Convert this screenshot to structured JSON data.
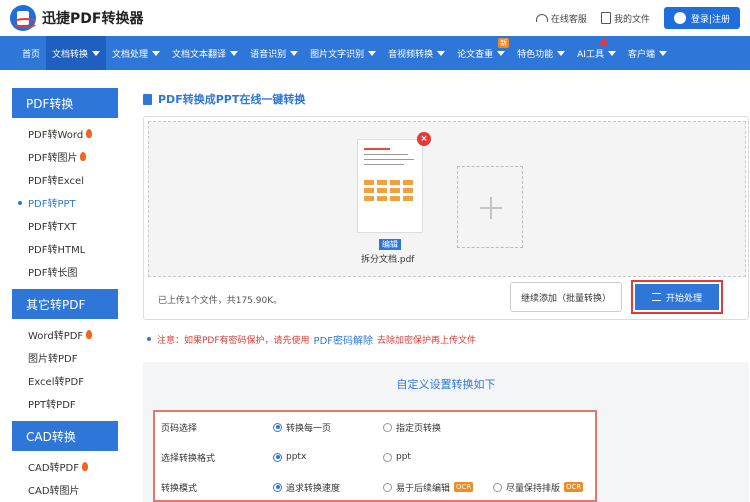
{
  "header": {
    "app_name": "迅捷PDF转换器",
    "service": "在线客服",
    "my_files": "我的文件",
    "login": "登录|注册"
  },
  "nav": {
    "items": [
      {
        "label": "首页"
      },
      {
        "label": "文档转换"
      },
      {
        "label": "文档处理"
      },
      {
        "label": "文档文本翻译"
      },
      {
        "label": "语音识别"
      },
      {
        "label": "图片文字识别"
      },
      {
        "label": "音视频转换"
      },
      {
        "label": "论文查重",
        "badge": "新"
      },
      {
        "label": "特色功能"
      },
      {
        "label": "AI工具"
      },
      {
        "label": "客户端"
      }
    ]
  },
  "sidebar": {
    "sections": [
      {
        "title": "PDF转换",
        "items": [
          "PDF转Word",
          "PDF转图片",
          "PDF转Excel",
          "PDF转PPT",
          "PDF转TXT",
          "PDF转HTML",
          "PDF转长图"
        ]
      },
      {
        "title": "其它转PDF",
        "items": [
          "Word转PDF",
          "图片转PDF",
          "Excel转PDF",
          "PPT转PDF"
        ]
      },
      {
        "title": "CAD转换",
        "items": [
          "CAD转PDF",
          "CAD转图片"
        ]
      }
    ]
  },
  "main": {
    "title": "PDF转换成PPT在线一键转换",
    "edit_tag": "编辑",
    "file_name": "拆分文档.pdf",
    "upload_status": "已上传1个文件，共175.90K。",
    "continue_btn": "继续添加（批量转换）",
    "start_btn": "开始处理",
    "notice_pre": "注意：如果PDF有密码保护，请先使用",
    "notice_link": "PDF密码解除",
    "notice_post": "去除加密保护再上传文件"
  },
  "settings": {
    "title": "自定义设置转换如下",
    "rows": [
      {
        "label": "页码选择",
        "opt1": "转换每一页",
        "opt2": "指定页转换",
        "opt3": ""
      },
      {
        "label": "选择转换格式",
        "opt1": "pptx",
        "opt2": "ppt",
        "opt3": ""
      },
      {
        "label": "转换模式",
        "opt1": "追求转换速度",
        "opt2": "易于后续编辑",
        "opt3": "尽量保持排版"
      }
    ],
    "ocr": "OCR"
  },
  "colors": {
    "brand": "#2e77d8",
    "alert": "#e53935",
    "badge": "#f08a24"
  }
}
